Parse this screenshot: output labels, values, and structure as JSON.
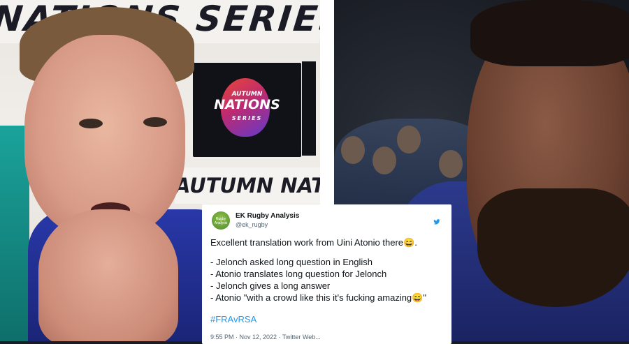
{
  "left_photo": {
    "banner_top_text": "NATIONS SERIES",
    "banner_bottom_text": "AUTUMN NATIONS",
    "logo": {
      "line1": "AUTUMN",
      "line2": "NATIONS",
      "line3": "SERIES"
    }
  },
  "tweet": {
    "display_name": "EK Rugby Analysis",
    "handle": "@ek_rugby",
    "avatar_text": "Rugby Analysis",
    "lines": [
      "Excellent translation work from Uini Atonio there😄.",
      "",
      "- Jelonch asked long question in English",
      "-  Atonio translates long question for Jelonch",
      "- Jelonch gives a long answer",
      "- Atonio \"with a crowd like this it's fucking amazing😄\""
    ],
    "hashtag": "#FRAvRSA",
    "footer": "9:55 PM · Nov 12, 2022 · Twitter Web..."
  },
  "icons": {
    "twitter": "twitter-bird-icon"
  }
}
